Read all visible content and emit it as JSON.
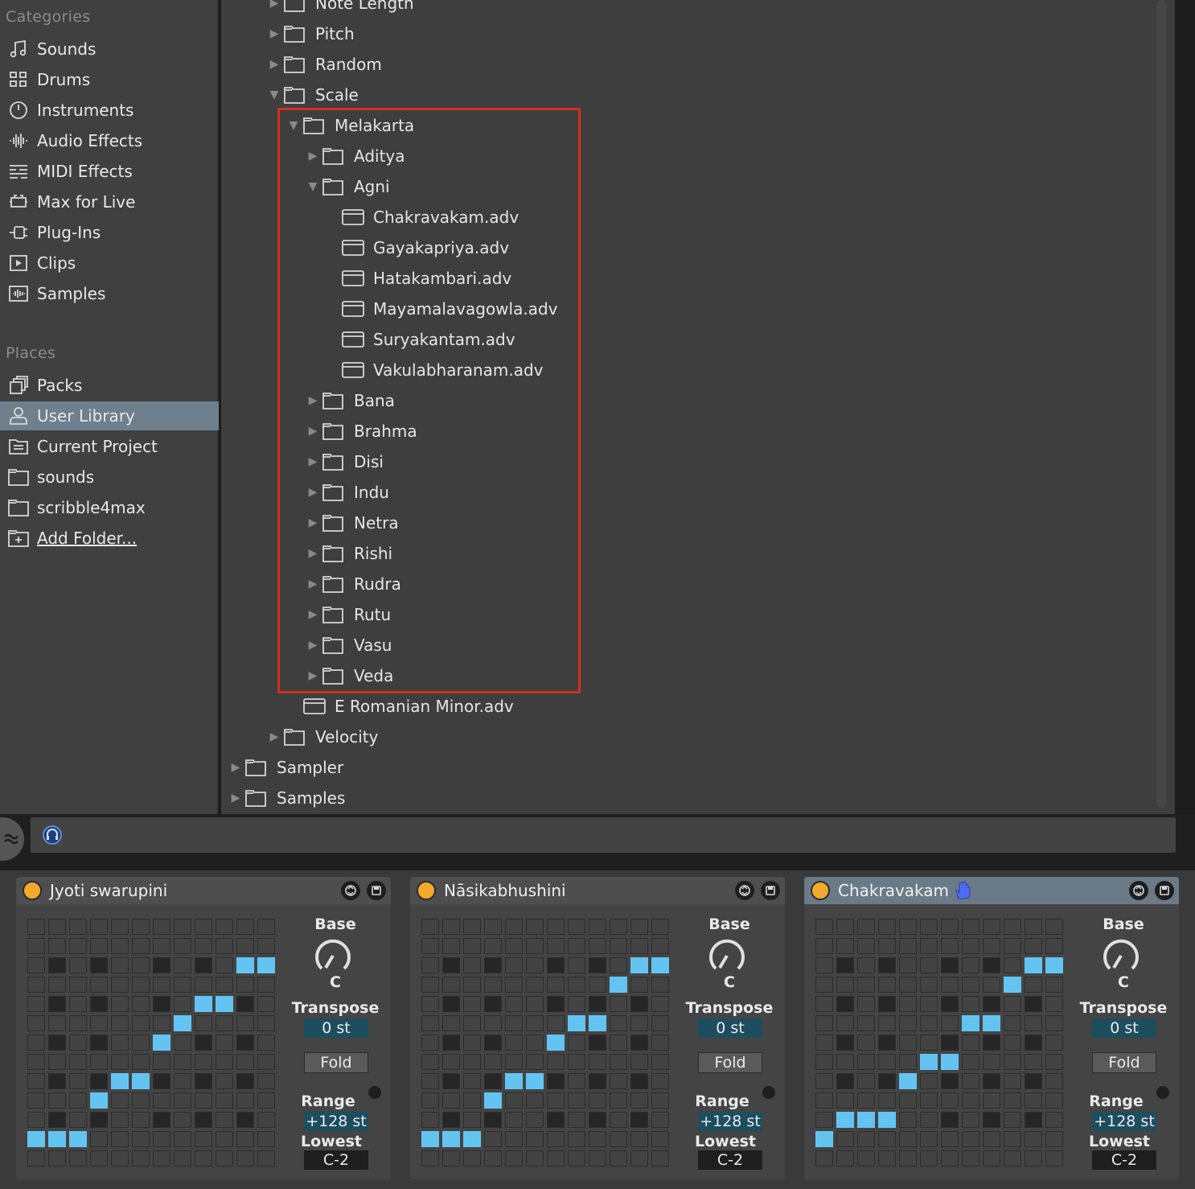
{
  "sidebar": {
    "categories_header": "Categories",
    "categories": [
      {
        "label": "Sounds",
        "icon": "note-icon"
      },
      {
        "label": "Drums",
        "icon": "grid-icon"
      },
      {
        "label": "Instruments",
        "icon": "clock-icon"
      },
      {
        "label": "Audio Effects",
        "icon": "waveform-icon"
      },
      {
        "label": "MIDI Effects",
        "icon": "midi-icon"
      },
      {
        "label": "Max for Live",
        "icon": "max-icon"
      },
      {
        "label": "Plug-Ins",
        "icon": "plug-icon"
      },
      {
        "label": "Clips",
        "icon": "clip-icon"
      },
      {
        "label": "Samples",
        "icon": "sample-icon"
      }
    ],
    "places_header": "Places",
    "places": [
      {
        "label": "Packs",
        "icon": "packs-icon"
      },
      {
        "label": "User Library",
        "icon": "user-icon"
      },
      {
        "label": "Current Project",
        "icon": "project-icon"
      },
      {
        "label": "sounds",
        "icon": "folder-icon"
      },
      {
        "label": "scribble4max",
        "icon": "folder-icon"
      },
      {
        "label": "Add Folder...",
        "icon": "add-folder-icon"
      }
    ]
  },
  "browser": {
    "rows": [
      {
        "label": "Note Length",
        "type": "folder",
        "expanded": false
      },
      {
        "label": "Pitch",
        "type": "folder",
        "expanded": false
      },
      {
        "label": "Random",
        "type": "folder",
        "expanded": false
      },
      {
        "label": "Scale",
        "type": "folder",
        "expanded": true
      },
      {
        "label": "Melakarta",
        "type": "folder",
        "expanded": true
      },
      {
        "label": "Aditya",
        "type": "folder",
        "expanded": false
      },
      {
        "label": "Agni",
        "type": "folder",
        "expanded": true
      },
      {
        "label": "Chakravakam.adv",
        "type": "preset"
      },
      {
        "label": "Gayakapriya.adv",
        "type": "preset"
      },
      {
        "label": "Hatakambari.adv",
        "type": "preset"
      },
      {
        "label": "Mayamalavagowla.adv",
        "type": "preset"
      },
      {
        "label": "Suryakantam.adv",
        "type": "preset"
      },
      {
        "label": "Vakulabharanam.adv",
        "type": "preset"
      },
      {
        "label": "Bana",
        "type": "folder",
        "expanded": false
      },
      {
        "label": "Brahma",
        "type": "folder",
        "expanded": false
      },
      {
        "label": "Disi",
        "type": "folder",
        "expanded": false
      },
      {
        "label": "Indu",
        "type": "folder",
        "expanded": false
      },
      {
        "label": "Netra",
        "type": "folder",
        "expanded": false
      },
      {
        "label": "Rishi",
        "type": "folder",
        "expanded": false
      },
      {
        "label": "Rudra",
        "type": "folder",
        "expanded": false
      },
      {
        "label": "Rutu",
        "type": "folder",
        "expanded": false
      },
      {
        "label": "Vasu",
        "type": "folder",
        "expanded": false
      },
      {
        "label": "Veda",
        "type": "folder",
        "expanded": false
      },
      {
        "label": "E Romanian Minor.adv",
        "type": "preset"
      },
      {
        "label": "Velocity",
        "type": "folder",
        "expanded": false
      },
      {
        "label": "Sampler",
        "type": "folder",
        "expanded": false
      },
      {
        "label": "Samples",
        "type": "folder",
        "expanded": false
      }
    ]
  },
  "devices": [
    {
      "name": "Jyoti swarupini",
      "active": false,
      "base_label": "Base",
      "base_value": "C",
      "transpose_label": "Transpose",
      "transpose_value": "0 st",
      "fold_label": "Fold",
      "range_label": "Range",
      "range_value": "+128 st",
      "lowest_label": "Lowest",
      "lowest_value": "C-2",
      "active_rows": [
        null,
        null,
        [
          11,
          12
        ],
        null,
        [
          9,
          10
        ],
        [
          8
        ],
        [
          7
        ],
        null,
        [
          5,
          6
        ],
        [
          4
        ],
        null,
        [
          1,
          2,
          3
        ]
      ]
    },
    {
      "name": "Nāsikabhushini",
      "active": false,
      "base_label": "Base",
      "base_value": "C",
      "transpose_label": "Transpose",
      "transpose_value": "0 st",
      "fold_label": "Fold",
      "range_label": "Range",
      "range_value": "+128 st",
      "lowest_label": "Lowest",
      "lowest_value": "C-2",
      "active_rows": [
        null,
        null,
        [
          11,
          12
        ],
        [
          10
        ],
        null,
        [
          8,
          9
        ],
        [
          7
        ],
        null,
        [
          5,
          6
        ],
        [
          4
        ],
        null,
        [
          1,
          2,
          3
        ]
      ]
    },
    {
      "name": "Chakravakam",
      "active": true,
      "base_label": "Base",
      "base_value": "C",
      "transpose_label": "Transpose",
      "transpose_value": "0 st",
      "fold_label": "Fold",
      "range_label": "Range",
      "range_value": "+128 st",
      "lowest_label": "Lowest",
      "lowest_value": "C-2",
      "active_rows": [
        null,
        null,
        [
          11,
          12
        ],
        [
          10
        ],
        null,
        [
          8,
          9
        ],
        null,
        [
          6,
          7
        ],
        [
          5
        ],
        null,
        [
          2,
          3,
          4
        ],
        [
          1
        ]
      ]
    }
  ],
  "colors": {
    "highlight": "#d42f1f",
    "active_cell": "#63c4f2",
    "power": "#f4a92c",
    "selected_row": "#6e7f8e"
  }
}
